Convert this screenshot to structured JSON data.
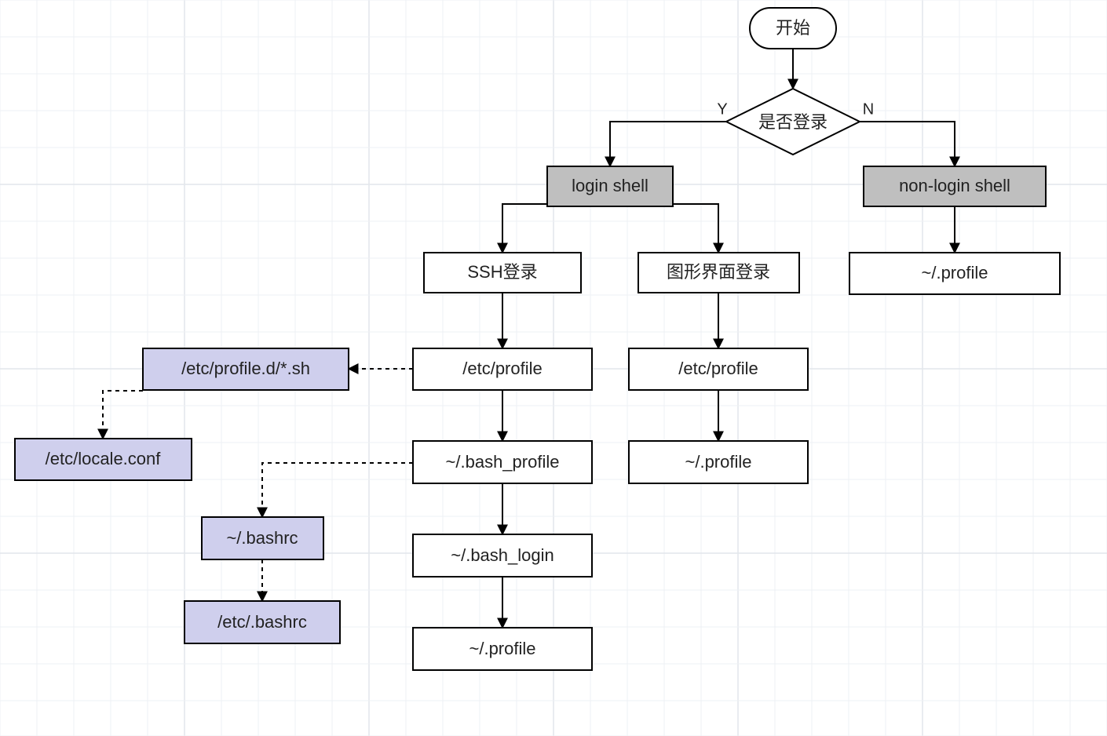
{
  "nodes": {
    "start": "开始",
    "decision": "是否登录",
    "login_shell": "login shell",
    "nonlogin": "non-login shell",
    "ssh": "SSH登录",
    "gui": "图形界面登录",
    "etc_profile1": "/etc/profile",
    "etc_profile2": "/etc/profile",
    "bash_profile": "~/.bash_profile",
    "bash_login": "~/.bash_login",
    "profile1": "~/.profile",
    "profile2": "~/.profile",
    "profile3": "~/.profile",
    "profiled": "/etc/profile.d/*.sh",
    "locale": "/etc/locale.conf",
    "bashrc": "~/.bashrc",
    "etc_bashrc": "/etc/.bashrc"
  },
  "edges": {
    "yes": "Y",
    "no": "N"
  },
  "colors": {
    "grid_minor": "#eef1f4",
    "grid_major": "#e2e6eb",
    "node_gray": "#bfbfbf",
    "node_lav": "#cfcfed",
    "stroke": "#000000"
  }
}
